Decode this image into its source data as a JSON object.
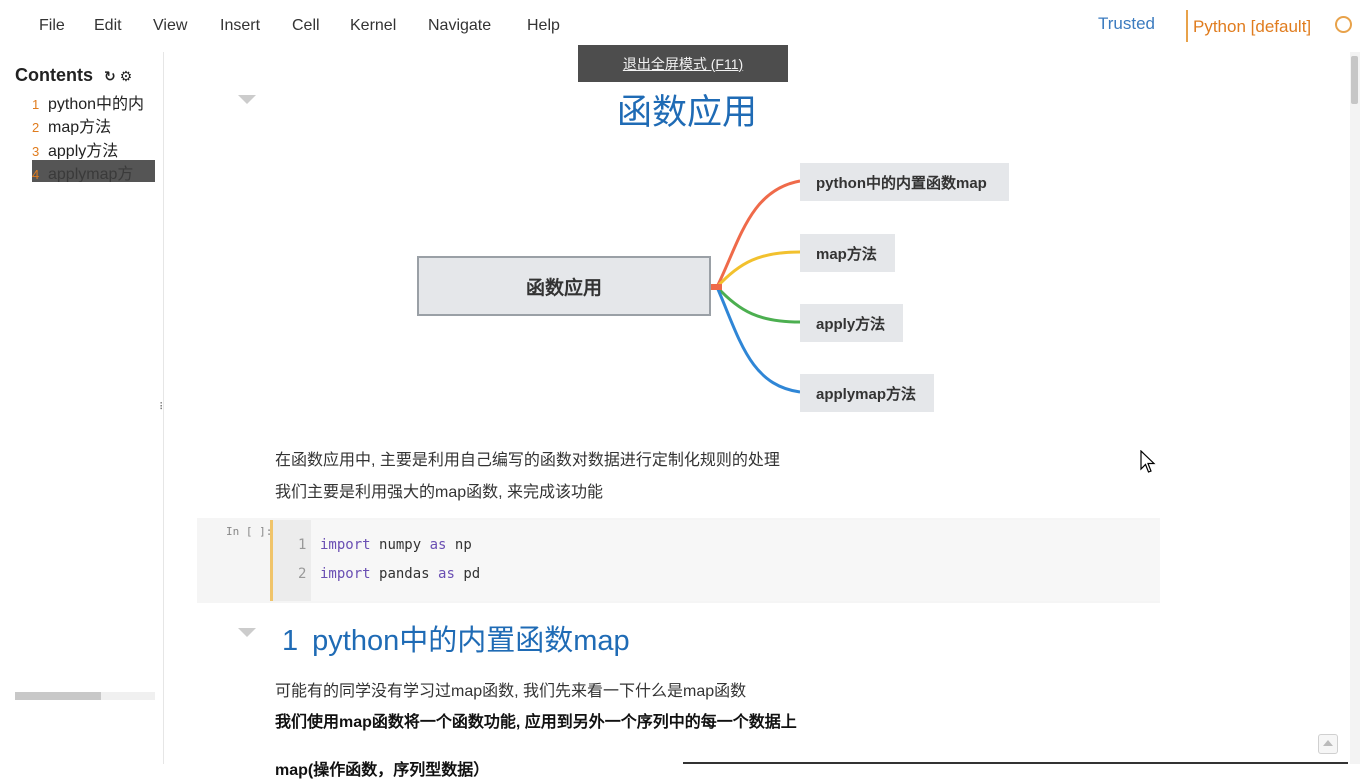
{
  "menu": {
    "items": [
      "File",
      "Edit",
      "View",
      "Insert",
      "Cell",
      "Kernel",
      "Navigate",
      "Help"
    ],
    "trusted": "Trusted",
    "kernel": "Python [default]"
  },
  "toast": {
    "text": "退出全屏模式 (F11)"
  },
  "toc": {
    "title": "Contents",
    "refresh_icon": "refresh-icon",
    "settings_icon": "gear-icon",
    "items": [
      {
        "num": "1",
        "label": "python中的内"
      },
      {
        "num": "2",
        "label": "map方法"
      },
      {
        "num": "3",
        "label": "apply方法"
      },
      {
        "num": "4",
        "label": "applymap方"
      }
    ]
  },
  "notebook": {
    "title": "函数应用",
    "mindmap": {
      "root": "函数应用",
      "branches": [
        {
          "label": "python中的内置函数map",
          "color": "#ef6a4a"
        },
        {
          "label": "map方法",
          "color": "#f2c12e"
        },
        {
          "label": "apply方法",
          "color": "#4caf50"
        },
        {
          "label": "applymap方法",
          "color": "#2f86d6"
        }
      ]
    },
    "intro_line1": "在函数应用中, 主要是利用自己编写的函数对数据进行定制化规则的处理",
    "intro_line2": "我们主要是利用强大的map函数, 来完成该功能",
    "code_cell": {
      "prompt": "In [ ]:",
      "lines": [
        {
          "n": "1",
          "kw1": "import",
          "mod": "numpy",
          "kw2": "as",
          "alias": "np"
        },
        {
          "n": "2",
          "kw1": "import",
          "mod": "pandas",
          "kw2": "as",
          "alias": "pd"
        }
      ]
    },
    "section1": {
      "num": "1",
      "title": "python中的内置函数map"
    },
    "sec1_line1": "可能有的同学没有学习过map函数, 我们先来看一下什么是map函数",
    "sec1_line2": "我们使用map函数将一个函数功能, 应用到另外一个序列中的每一个数据上",
    "sec1_line3": "map(操作函数，序列型数据）"
  }
}
